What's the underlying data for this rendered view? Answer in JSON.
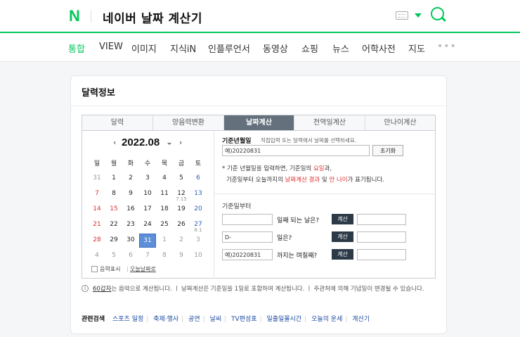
{
  "header": {
    "logo": "N",
    "query": "네이버 날짜 계산기"
  },
  "nav": [
    "통합",
    "VIEW",
    "이미지",
    "지식iN",
    "인플루언서",
    "동영상",
    "쇼핑",
    "뉴스",
    "어학사전",
    "지도"
  ],
  "nav_more": "•••",
  "card": {
    "title": "달력정보",
    "tabs": [
      "달력",
      "양음력변환",
      "날짜계산",
      "전역일계산",
      "만나이계산"
    ],
    "active_tab": 2
  },
  "calendar": {
    "month_label": "2022.08",
    "prev": "‹",
    "next": "›",
    "weekdays": [
      "일",
      "월",
      "화",
      "수",
      "목",
      "금",
      "토"
    ],
    "weeks": [
      [
        "31",
        "1",
        "2",
        "3",
        "4",
        "5",
        "6"
      ],
      [
        "7",
        "8",
        "9",
        "10",
        "11",
        "12",
        "13"
      ],
      [
        "14",
        "15",
        "16",
        "17",
        "18",
        "19",
        "20"
      ],
      [
        "21",
        "22",
        "23",
        "24",
        "25",
        "26",
        "27"
      ],
      [
        "28",
        "29",
        "30",
        "31",
        "1",
        "2",
        "3"
      ],
      [
        "4",
        "5",
        "6",
        "7",
        "8",
        "9",
        "10"
      ]
    ],
    "notes": {
      "12": "7.15",
      "27": "8.1"
    },
    "lunar_label": "음력표시",
    "today_label": "오늘날짜로"
  },
  "calc": {
    "base_label": "기준년월일",
    "base_hint": "직접입력 또는 달력에서 날짜를 선택하세요.",
    "base_value": "예)20220831",
    "reset_label": "초기화",
    "note": {
      "line1_prefix": "* 기준 년월일을 입력하면, 기준일의 ",
      "line1_red": "요일",
      "line1_suffix": "과,",
      "line2_prefix": "기준일부터 오늘까지의 ",
      "line2_red1": "날짜계산 결과",
      "line2_mid": " 및 ",
      "line2_red2": "만 나이",
      "line2_suffix": "가 표기됩니다."
    },
    "sub_label": "기준일부터",
    "q1_label": "일째 되는 날은?",
    "q2_value": "D-",
    "q2_label": "일은?",
    "q3_value": "예)20220831",
    "q3_label": "까지는 며칠째?",
    "calc_label": "계산"
  },
  "info": {
    "icon": "i",
    "link": "60갑자",
    "text": "는 음력으로 계산됩니다. ㅣ 날짜계산은 기준일을 1일로 포함하여 계산됩니다. ㅣ 주관처에 의해 기념일이 변경될 수 있습니다."
  },
  "related": {
    "title": "관련검색",
    "links": [
      "스포츠 일정",
      "축제·행사",
      "공연",
      "날씨",
      "TV편성표",
      "일출일몰시간",
      "오늘의 운세",
      "계산기"
    ]
  },
  "colors": {
    "brand": "#03c75a",
    "sunday": "#e03131",
    "saturday": "#2b5fb7",
    "selected": "#5c8ed9"
  }
}
